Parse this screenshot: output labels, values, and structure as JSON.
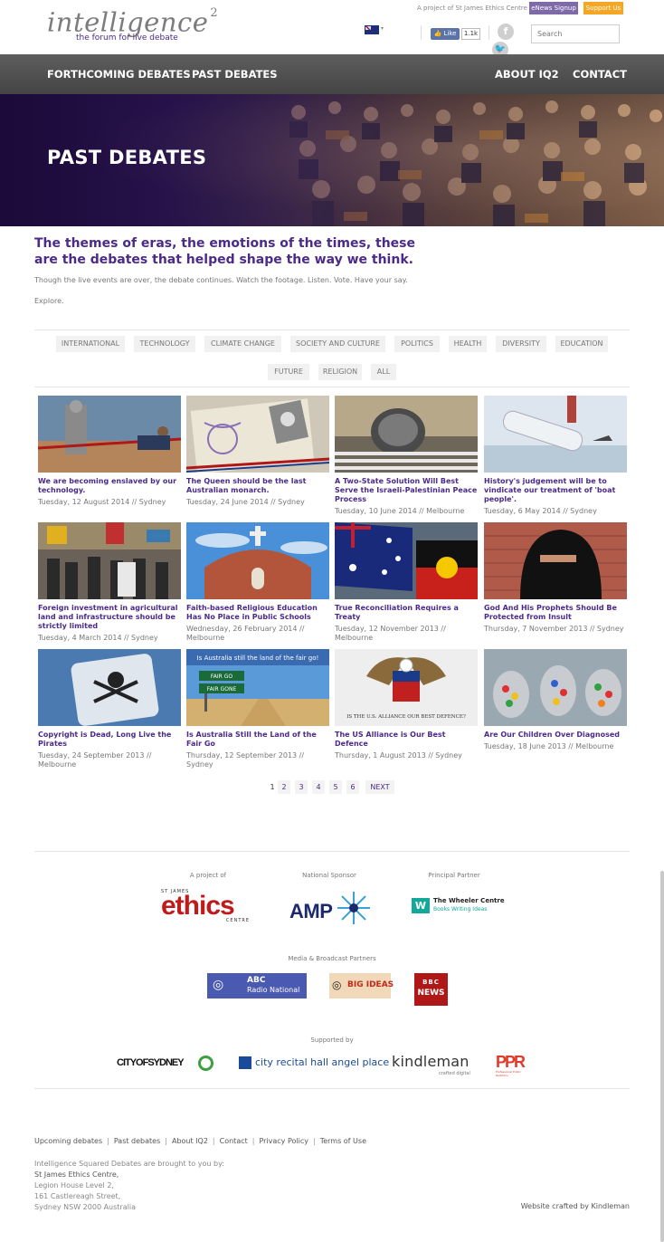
{
  "header": {
    "logo_main": "intelligence",
    "logo_sup": "2",
    "logo_sub": "the forum for live debate",
    "project_text": "A project of St James Ethics Centre",
    "enews_label": "eNews Signup",
    "support_label": "Support Us",
    "fb_like_label": "Like",
    "fb_count": "1.1k",
    "search_placeholder": "Search"
  },
  "nav": {
    "items": [
      "FORTHCOMING DEBATES",
      "PAST DEBATES",
      "ABOUT IQ2",
      "CONTACT"
    ]
  },
  "hero": {
    "title": "PAST DEBATES"
  },
  "intro": {
    "heading": "The themes of eras, the emotions of the times, these are the debates that helped shape the way we think.",
    "paragraph": "Though the live events are over, the debate continues. Watch the footage. Listen. Vote. Have your say.",
    "explore": "Explore."
  },
  "filters": [
    "INTERNATIONAL",
    "TECHNOLOGY",
    "CLIMATE CHANGE",
    "SOCIETY AND CULTURE",
    "POLITICS",
    "HEALTH",
    "DIVERSITY",
    "EDUCATION",
    "FUTURE",
    "RELIGION",
    "ALL"
  ],
  "debates": [
    {
      "title": "We are becoming enslaved by our technology.",
      "meta": "Tuesday, 12 August 2014 // Sydney"
    },
    {
      "title": "The Queen should be the last Australian monarch.",
      "meta": "Tuesday, 24 June 2014 // Sydney"
    },
    {
      "title": "A Two-State Solution Will Best Serve the Israeli-Palestinian Peace Process",
      "meta": "Tuesday, 10 June 2014 // Melbourne"
    },
    {
      "title": "History's judgement will be to vindicate our treatment of 'boat people'.",
      "meta": "Tuesday, 6 May 2014 // Sydney"
    },
    {
      "title": "Foreign investment in agricultural land and infrastructure should be strictly limited",
      "meta": "Tuesday, 4 March 2014 // Sydney"
    },
    {
      "title": "Faith-based Religious Education Has No Place in Public Schools",
      "meta": "Wednesday, 26 February 2014 // Melbourne"
    },
    {
      "title": "True Reconciliation Requires a Treaty",
      "meta": "Tuesday, 12 November 2013 // Melbourne"
    },
    {
      "title": "God And His Prophets Should Be Protected from Insult",
      "meta": "Thursday, 7 November 2013 // Sydney"
    },
    {
      "title": "Copyright is Dead, Long Live the Pirates",
      "meta": "Tuesday, 24 September 2013 // Melbourne"
    },
    {
      "title": "Is Australia Still the Land of the Fair Go",
      "meta": "Thursday, 12 September 2013 // Sydney"
    },
    {
      "title": "The US Alliance is Our Best Defence",
      "meta": "Thursday, 1 August 2013 // Sydney"
    },
    {
      "title": "Are Our Children Over Diagnosed",
      "meta": "Tuesday, 18 June 2013 // Melbourne"
    }
  ],
  "image_text": {
    "fairgo_banner": "Is Australia still the land of the fair go!",
    "fairgo_sign1": "FAIR GO",
    "fairgo_sign2": "FAIR GONE",
    "alliance_text": "IS THE U.S. ALLIANCE OUR BEST DEFENCE?"
  },
  "pagination": [
    "1",
    "2",
    "3",
    "4",
    "5",
    "6",
    "NEXT"
  ],
  "sponsors": {
    "project_of_label": "A project of",
    "national_label": "National Sponsor",
    "principal_label": "Principal Partner",
    "ethics_top": "ST JAMES",
    "ethics_name": "ethics",
    "ethics_bottom": "CENTRE",
    "amp_name": "AMP",
    "wheeler_name": "The Wheeler Centre",
    "wheeler_sub": "Books Writing Ideas",
    "media_label": "Media & Broadcast Partners",
    "abc_line1": "ABC",
    "abc_line2": "Radio National",
    "bigideas_label": "BIG IDEAS",
    "bbc_line1": "BBC",
    "bbc_line2": "NEWS",
    "supported_label": "Supported by",
    "cityofsydney": "CITYOFSYDNEY",
    "recital": "city recital hall angel place",
    "kindleman": "kindleman",
    "kindleman_sub": "crafted digital",
    "ppr_sub": "Professional Public Relations"
  },
  "footer": {
    "links": [
      "Upcoming debates",
      "Past debates",
      "About IQ2",
      "Contact",
      "Privacy Policy",
      "Terms of Use"
    ],
    "brought_by": "Intelligence Squared Debates are brought to you by:",
    "org": "St James Ethics Centre,",
    "addr1": "Legion House Level 2,",
    "addr2": "161 Castlereagh Street,",
    "addr3": "Sydney NSW 2000 Australia",
    "crafted": "Website crafted by Kindleman"
  },
  "colors": {
    "brand_purple": "#4b2a8a",
    "nav_bg": "#4f4f4f",
    "enews_bg": "#7e6aa8",
    "support_bg": "#f5a623"
  }
}
